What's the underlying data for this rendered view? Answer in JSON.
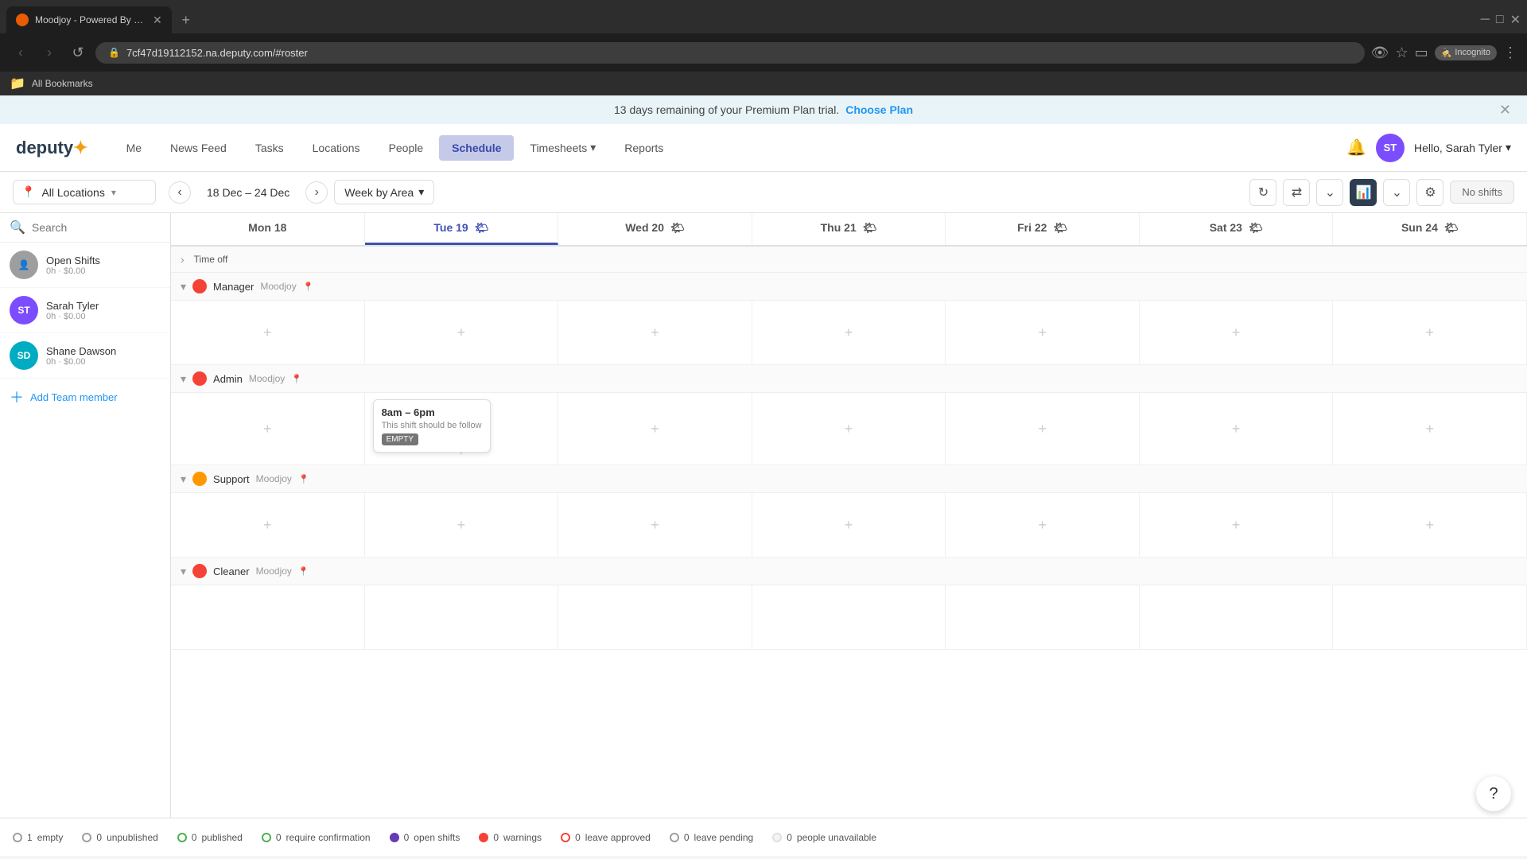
{
  "browser": {
    "tab_title": "Moodjoy - Powered By Deputy",
    "url": "7cf47d19112152.na.deputy.com/#roster",
    "incognito_label": "Incognito",
    "bookmarks_label": "All Bookmarks",
    "new_tab_icon": "+"
  },
  "banner": {
    "message": "13 days remaining of your Premium Plan trial.",
    "link_text": "Choose Plan"
  },
  "nav": {
    "logo_text": "deputy",
    "items": [
      {
        "label": "Me",
        "active": false
      },
      {
        "label": "News Feed",
        "active": false
      },
      {
        "label": "Tasks",
        "active": false
      },
      {
        "label": "Locations",
        "active": false
      },
      {
        "label": "People",
        "active": false
      },
      {
        "label": "Schedule",
        "active": true
      },
      {
        "label": "Timesheets",
        "active": false,
        "has_dropdown": true
      },
      {
        "label": "Reports",
        "active": false
      }
    ],
    "user_initials": "ST",
    "user_greeting": "Hello, Sarah Tyler"
  },
  "schedule_toolbar": {
    "location_label": "All Locations",
    "week_range": "18 Dec – 24 Dec",
    "view_label": "Week by Area",
    "no_shifts_label": "No shifts"
  },
  "grid": {
    "days": [
      {
        "label": "Mon 18",
        "today": false
      },
      {
        "label": "Tue 19",
        "today": true,
        "weather": true
      },
      {
        "label": "Wed 20",
        "today": false,
        "weather": true
      },
      {
        "label": "Thu 21",
        "today": false,
        "weather": true
      },
      {
        "label": "Fri 22",
        "today": false,
        "weather": true
      },
      {
        "label": "Sat 23",
        "today": false,
        "weather": true
      },
      {
        "label": "Sun 24",
        "today": false,
        "weather": true
      }
    ],
    "sections": [
      {
        "id": "time-off",
        "name": "Time off",
        "special": true,
        "collapsed": false,
        "dot_color": ""
      },
      {
        "id": "manager",
        "name": "Manager",
        "location": "Moodjoy",
        "collapsed": false,
        "dot_color": "red",
        "shift": null
      },
      {
        "id": "admin",
        "name": "Admin",
        "location": "Moodjoy",
        "collapsed": false,
        "dot_color": "red",
        "shift": {
          "day_index": 1,
          "time": "8am – 6pm",
          "note": "This shift should be follow",
          "badge": "EMPTY"
        }
      },
      {
        "id": "support",
        "name": "Support",
        "location": "Moodjoy",
        "collapsed": false,
        "dot_color": "orange",
        "shift": null
      },
      {
        "id": "cleaner",
        "name": "Cleaner",
        "location": "Moodjoy",
        "collapsed": false,
        "dot_color": "red",
        "shift": null
      }
    ]
  },
  "sidebar": {
    "search_placeholder": "Search",
    "people": [
      {
        "name": "Open Shifts",
        "hours": "0h · $0.00",
        "initials": "",
        "color": "gray"
      },
      {
        "name": "Sarah Tyler",
        "hours": "0h · $0.00",
        "initials": "ST",
        "color": "purple"
      },
      {
        "name": "Shane Dawson",
        "hours": "0h · $0.00",
        "initials": "SD",
        "color": "teal"
      }
    ],
    "add_member_label": "Add Team member"
  },
  "status_bar": {
    "items": [
      {
        "type": "empty",
        "count": "1",
        "label": "empty"
      },
      {
        "type": "unpublished",
        "count": "0",
        "label": "unpublished"
      },
      {
        "type": "published",
        "count": "0",
        "label": "published"
      },
      {
        "type": "require-confirm",
        "count": "0",
        "label": "require confirmation"
      },
      {
        "type": "open-shifts",
        "count": "0",
        "label": "open shifts"
      },
      {
        "type": "warnings",
        "count": "0",
        "label": "warnings"
      },
      {
        "type": "leave-approved",
        "count": "0",
        "label": "leave approved"
      },
      {
        "type": "leave-pending",
        "count": "0",
        "label": "leave pending"
      },
      {
        "type": "unavailable",
        "count": "0",
        "label": "people unavailable"
      }
    ]
  },
  "help_button_label": "?"
}
